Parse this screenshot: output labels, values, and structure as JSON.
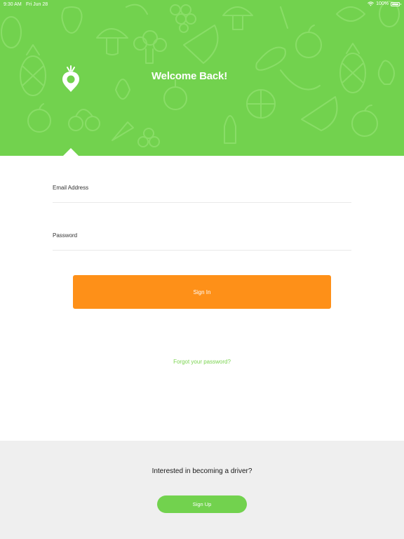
{
  "status_bar": {
    "time": "9:30 AM",
    "date": "Fri Jun 28",
    "battery": "100%"
  },
  "header": {
    "title": "Welcome Back!"
  },
  "form": {
    "email_label": "Email Address",
    "email_value": "",
    "password_label": "Password",
    "password_value": "",
    "signin_label": "Sign In",
    "forgot_label": "Forgot your password?"
  },
  "footer": {
    "prompt": "Interested in becoming a driver?",
    "signup_label": "Sign Up"
  },
  "colors": {
    "brand_green": "#72d24e",
    "accent_orange": "#fe9018",
    "footer_bg": "#efefef"
  }
}
